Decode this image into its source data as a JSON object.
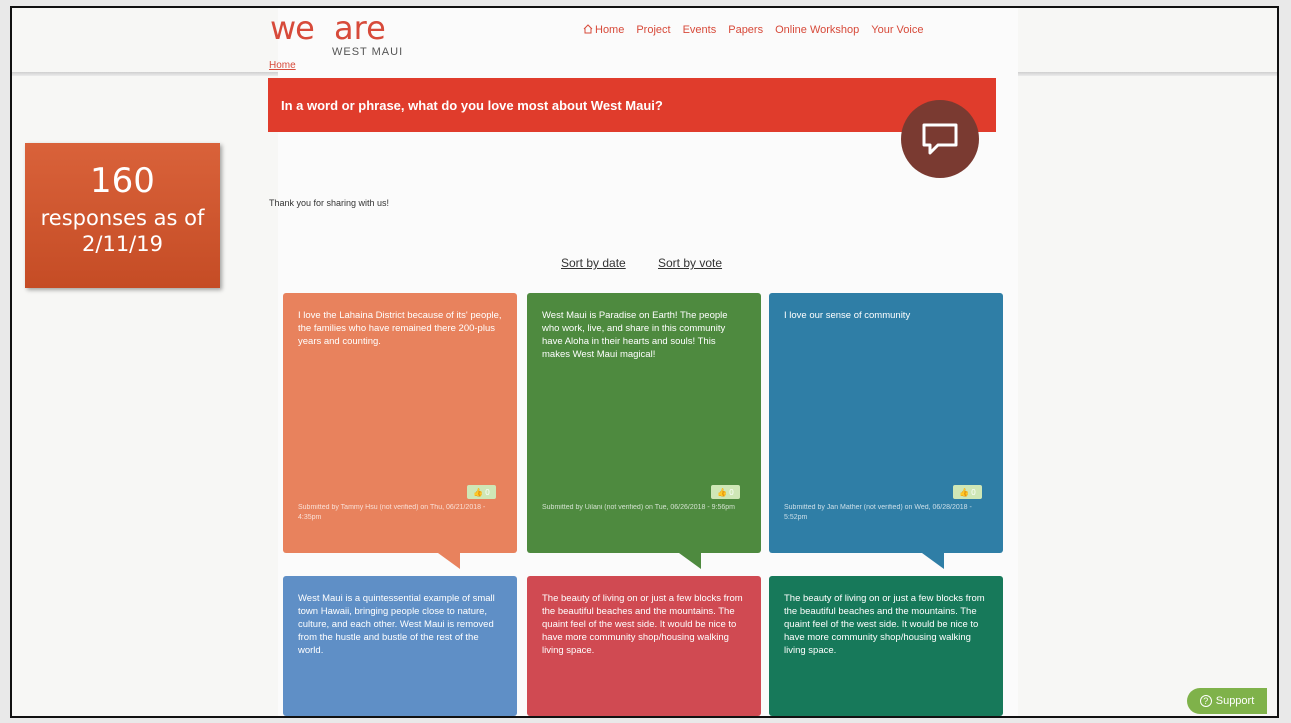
{
  "logo": {
    "we": "we",
    "are": "are",
    "sub": "WEST MAUI"
  },
  "nav": [
    "Home",
    "Project",
    "Events",
    "Papers",
    "Online Workshop",
    "Your Voice"
  ],
  "breadcrumb": "Home",
  "question": "In a word or phrase, what do you love most about West Maui?",
  "stat": {
    "number": "160",
    "text": "responses as of 2/11/19"
  },
  "thanks": "Thank you for sharing with us!",
  "sort": {
    "by_date": "Sort by date",
    "by_vote": "Sort by vote"
  },
  "cards": [
    {
      "text": "I love the Lahaina District because of its' people, the families who have remained there 200-plus years and counting.",
      "meta": "Submitted by Tammy Hsu (not verified) on Thu, 06/21/2018 - 4:35pm",
      "votes": "0",
      "color": "#e8825d"
    },
    {
      "text": "West Maui is Paradise on Earth! The people who work, live, and share in this community have Aloha in their hearts and souls! This makes West Maui magical!",
      "meta": "Submitted by Uilani (not verified) on Tue, 06/26/2018 - 9:56pm",
      "votes": "0",
      "color": "#4e8a3f"
    },
    {
      "text": "I love our sense of community",
      "meta": "Submitted by Jan Mather (not verified) on Wed, 06/28/2018 - 5:52pm",
      "votes": "0",
      "color": "#2f7ea6"
    },
    {
      "text": "West Maui is a quintessential example of small town Hawaii, bringing people close to nature, culture, and each other. West Maui is removed from the hustle and bustle of the rest of the world.",
      "color": "#5f8fc6"
    },
    {
      "text": "The beauty of living on or just a few blocks from the beautiful beaches and the mountains. The quaint feel of the west side. It would be nice to have more community shop/housing walking living space.",
      "color": "#d04a52"
    },
    {
      "text": "The beauty of living on or just a few blocks from the beautiful beaches and the mountains. The quaint feel of the west side. It would be nice to have more community shop/housing walking living space.",
      "color": "#17795a"
    }
  ],
  "support": "Support"
}
